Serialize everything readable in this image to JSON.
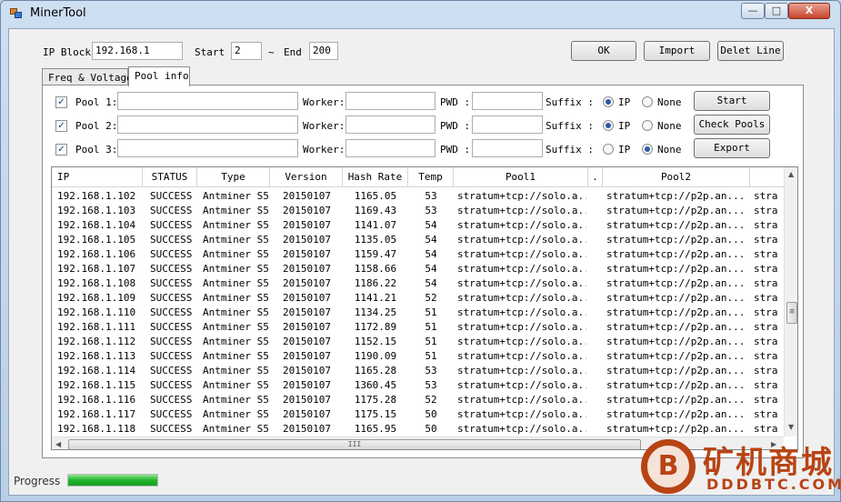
{
  "window": {
    "title": "MinerTool",
    "minimize": "—",
    "maximize": "□",
    "close": "X"
  },
  "ipblock": {
    "label": "IP Block",
    "value": "192.168.1",
    "start_label": "Start",
    "start_value": "2",
    "tilde": "~",
    "end_label": "End",
    "end_value": "200"
  },
  "toolbar": {
    "ok": "OK",
    "import": "Import",
    "delete": "Delet Line"
  },
  "tabs": [
    {
      "label": "Freq & Voltage"
    },
    {
      "label": "Pool info"
    }
  ],
  "pools": [
    {
      "label": "Pool 1:",
      "checked": "✓",
      "worker_label": "Worker:",
      "pwd_label": "PWD :",
      "suffix_label": "Suffix :",
      "opt_ip": "IP",
      "opt_none": "None",
      "suffix_selected": "IP",
      "action": "Start"
    },
    {
      "label": "Pool 2:",
      "checked": "✓",
      "worker_label": "Worker:",
      "pwd_label": "PWD :",
      "suffix_label": "Suffix :",
      "opt_ip": "IP",
      "opt_none": "None",
      "suffix_selected": "IP",
      "action": "Check Pools"
    },
    {
      "label": "Pool 3:",
      "checked": "✓",
      "worker_label": "Worker:",
      "pwd_label": "PWD :",
      "suffix_label": "Suffix :",
      "opt_ip": "IP",
      "opt_none": "None",
      "suffix_selected": "None",
      "action": "Export"
    }
  ],
  "table": {
    "columns": [
      "IP",
      "STATUS",
      "Type",
      "Version",
      "Hash Rate",
      "Temp",
      "Pool1",
      ".",
      "Pool2",
      ""
    ],
    "rows": [
      [
        "192.168.1.102",
        "SUCCESS",
        "Antminer S5",
        "20150107",
        "1165.05",
        "53",
        "stratum+tcp://solo.a...",
        "stratum+tcp://p2p.an...",
        "stra"
      ],
      [
        "192.168.1.103",
        "SUCCESS",
        "Antminer S5",
        "20150107",
        "1169.43",
        "53",
        "stratum+tcp://solo.a...",
        "stratum+tcp://p2p.an...",
        "stra"
      ],
      [
        "192.168.1.104",
        "SUCCESS",
        "Antminer S5",
        "20150107",
        "1141.07",
        "54",
        "stratum+tcp://solo.a...",
        "stratum+tcp://p2p.an...",
        "stra"
      ],
      [
        "192.168.1.105",
        "SUCCESS",
        "Antminer S5",
        "20150107",
        "1135.05",
        "54",
        "stratum+tcp://solo.a...",
        "stratum+tcp://p2p.an...",
        "stra"
      ],
      [
        "192.168.1.106",
        "SUCCESS",
        "Antminer S5",
        "20150107",
        "1159.47",
        "54",
        "stratum+tcp://solo.a...",
        "stratum+tcp://p2p.an...",
        "stra"
      ],
      [
        "192.168.1.107",
        "SUCCESS",
        "Antminer S5",
        "20150107",
        "1158.66",
        "54",
        "stratum+tcp://solo.a...",
        "stratum+tcp://p2p.an...",
        "stra"
      ],
      [
        "192.168.1.108",
        "SUCCESS",
        "Antminer S5",
        "20150107",
        "1186.22",
        "54",
        "stratum+tcp://solo.a...",
        "stratum+tcp://p2p.an...",
        "stra"
      ],
      [
        "192.168.1.109",
        "SUCCESS",
        "Antminer S5",
        "20150107",
        "1141.21",
        "52",
        "stratum+tcp://solo.a...",
        "stratum+tcp://p2p.an...",
        "stra"
      ],
      [
        "192.168.1.110",
        "SUCCESS",
        "Antminer S5",
        "20150107",
        "1134.25",
        "51",
        "stratum+tcp://solo.a...",
        "stratum+tcp://p2p.an...",
        "stra"
      ],
      [
        "192.168.1.111",
        "SUCCESS",
        "Antminer S5",
        "20150107",
        "1172.89",
        "51",
        "stratum+tcp://solo.a...",
        "stratum+tcp://p2p.an...",
        "stra"
      ],
      [
        "192.168.1.112",
        "SUCCESS",
        "Antminer S5",
        "20150107",
        "1152.15",
        "51",
        "stratum+tcp://solo.a...",
        "stratum+tcp://p2p.an...",
        "stra"
      ],
      [
        "192.168.1.113",
        "SUCCESS",
        "Antminer S5",
        "20150107",
        "1190.09",
        "51",
        "stratum+tcp://solo.a...",
        "stratum+tcp://p2p.an...",
        "stra"
      ],
      [
        "192.168.1.114",
        "SUCCESS",
        "Antminer S5",
        "20150107",
        "1165.28",
        "53",
        "stratum+tcp://solo.a...",
        "stratum+tcp://p2p.an...",
        "stra"
      ],
      [
        "192.168.1.115",
        "SUCCESS",
        "Antminer S5",
        "20150107",
        "1360.45",
        "53",
        "stratum+tcp://solo.a...",
        "stratum+tcp://p2p.an...",
        "stra"
      ],
      [
        "192.168.1.116",
        "SUCCESS",
        "Antminer S5",
        "20150107",
        "1175.28",
        "52",
        "stratum+tcp://solo.a...",
        "stratum+tcp://p2p.an...",
        "stra"
      ],
      [
        "192.168.1.117",
        "SUCCESS",
        "Antminer S5",
        "20150107",
        "1175.15",
        "50",
        "stratum+tcp://solo.a...",
        "stratum+tcp://p2p.an...",
        "stra"
      ],
      [
        "192.168.1.118",
        "SUCCESS",
        "Antminer S5",
        "20150107",
        "1165.95",
        "50",
        "stratum+tcp://solo.a...",
        "stratum+tcp://p2p.an...",
        "stra"
      ]
    ]
  },
  "scroll": {
    "up": "▲",
    "down": "▼",
    "left": "◀",
    "right": "▶",
    "grip_v": "≡",
    "grip_h": "III"
  },
  "status": {
    "label": "Progress",
    "progress": 1.0
  },
  "watermark": {
    "coin": "B",
    "cn": "矿机商城",
    "en": "DDDBTC.COM"
  },
  "colors": {
    "progress": "#21b52b",
    "watermark": "#b84414"
  }
}
